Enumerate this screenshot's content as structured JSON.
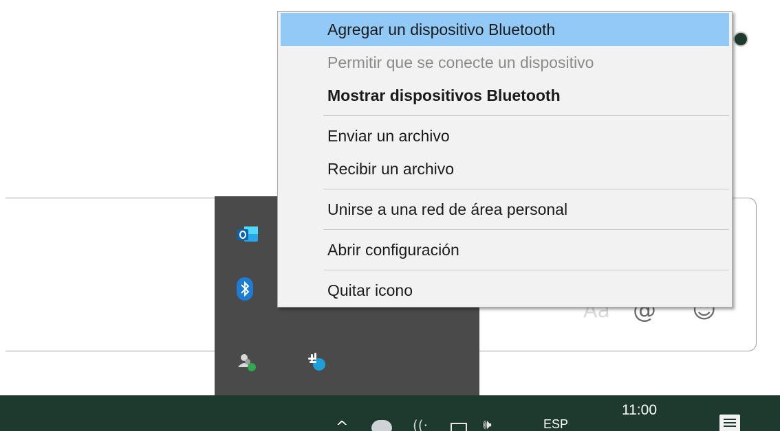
{
  "context_menu": {
    "items": [
      {
        "label": "Agregar un dispositivo Bluetooth",
        "state": "highlighted"
      },
      {
        "label": "Permitir que se conecte un dispositivo",
        "state": "disabled"
      },
      {
        "label": "Mostrar dispositivos Bluetooth",
        "state": "default-bold"
      },
      {
        "label": "Enviar un archivo",
        "state": "normal"
      },
      {
        "label": "Recibir un archivo",
        "state": "normal"
      },
      {
        "label": "Unirse a una red de área personal",
        "state": "normal"
      },
      {
        "label": "Abrir configuración",
        "state": "normal"
      },
      {
        "label": "Quitar icono",
        "state": "normal"
      }
    ]
  },
  "tray_flyout": {
    "icons": [
      "outlook-icon",
      "bluetooth-icon",
      "people-sync-icon",
      "slack-icon"
    ]
  },
  "compose_toolbar": {
    "format_glyph": "Aa",
    "mention_glyph": "@",
    "emoji_glyph": "☺"
  },
  "taskbar": {
    "language": "ESP",
    "clock": "11:00",
    "chevron_glyph": "^",
    "wifi_glyph": "((·",
    "volume_glyph": "🕪"
  },
  "colors": {
    "menu_highlight": "#91c9f7",
    "menu_bg": "#f2f2f2",
    "flyout_bg": "#4a4a4a",
    "taskbar_bg": "#1e3a2e",
    "bluetooth_blue": "#1c7cd6"
  }
}
